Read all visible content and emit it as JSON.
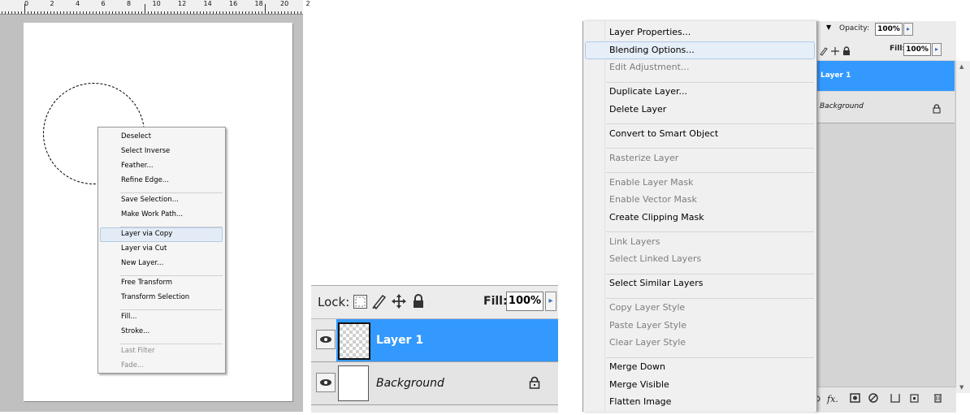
{
  "ruler": {
    "numbers": [
      "0",
      "2",
      "4",
      "6",
      "8",
      "10",
      "12",
      "14",
      "16",
      "18",
      "20",
      "2"
    ]
  },
  "context_menu_selection": {
    "groups": [
      [
        "Deselect",
        "Select Inverse",
        "Feather...",
        "Refine Edge..."
      ],
      [
        "Save Selection...",
        "Make Work Path..."
      ],
      [
        "Layer via Copy",
        "Layer via Cut",
        "New Layer..."
      ],
      [
        "Free Transform",
        "Transform Selection"
      ],
      [
        "Fill...",
        "Stroke..."
      ],
      [
        "Last Filter",
        "Fade..."
      ]
    ],
    "highlighted": "Layer via Copy",
    "disabled": [
      "Last Filter",
      "Fade..."
    ]
  },
  "layers_zoom": {
    "lock_label": "Lock:",
    "fill_label": "Fill:",
    "fill_value": "100%",
    "layers": [
      {
        "name": "Layer 1",
        "selected": true
      },
      {
        "name": "Background",
        "selected": false,
        "locked": true
      }
    ]
  },
  "layers_panel": {
    "opacity_label": "Opacity:",
    "opacity_value": "100%",
    "fill_label": "Fill:",
    "fill_value": "100%",
    "layers": [
      {
        "name": "Layer 1",
        "selected": true
      },
      {
        "name": "Background",
        "locked": true
      }
    ],
    "bottom_icons": [
      "link-icon",
      "fx-icon",
      "mask-icon",
      "adjustment-icon",
      "folder-icon",
      "new-layer-icon",
      "trash-icon"
    ]
  },
  "context_menu_layer": {
    "groups": [
      [
        "Layer Properties...",
        "Blending Options...",
        "Edit Adjustment..."
      ],
      [
        "Duplicate Layer...",
        "Delete Layer"
      ],
      [
        "Convert to Smart Object"
      ],
      [
        "Rasterize Layer"
      ],
      [
        "Enable Layer Mask",
        "Enable Vector Mask",
        "Create Clipping Mask"
      ],
      [
        "Link Layers",
        "Select Linked Layers"
      ],
      [
        "Select Similar Layers"
      ],
      [
        "Copy Layer Style",
        "Paste Layer Style",
        "Clear Layer Style"
      ],
      [
        "Merge Down",
        "Merge Visible",
        "Flatten Image"
      ]
    ],
    "highlighted": "Blending Options...",
    "disabled": [
      "Edit Adjustment...",
      "Rasterize Layer",
      "Enable Layer Mask",
      "Enable Vector Mask",
      "Link Layers",
      "Select Linked Layers",
      "Copy Layer Style",
      "Paste Layer Style",
      "Clear Layer Style"
    ]
  },
  "colors": {
    "selection_blue": "#3399ff",
    "menu_bg": "#f0f0f0",
    "canvas_gray": "#c0c0c0"
  }
}
